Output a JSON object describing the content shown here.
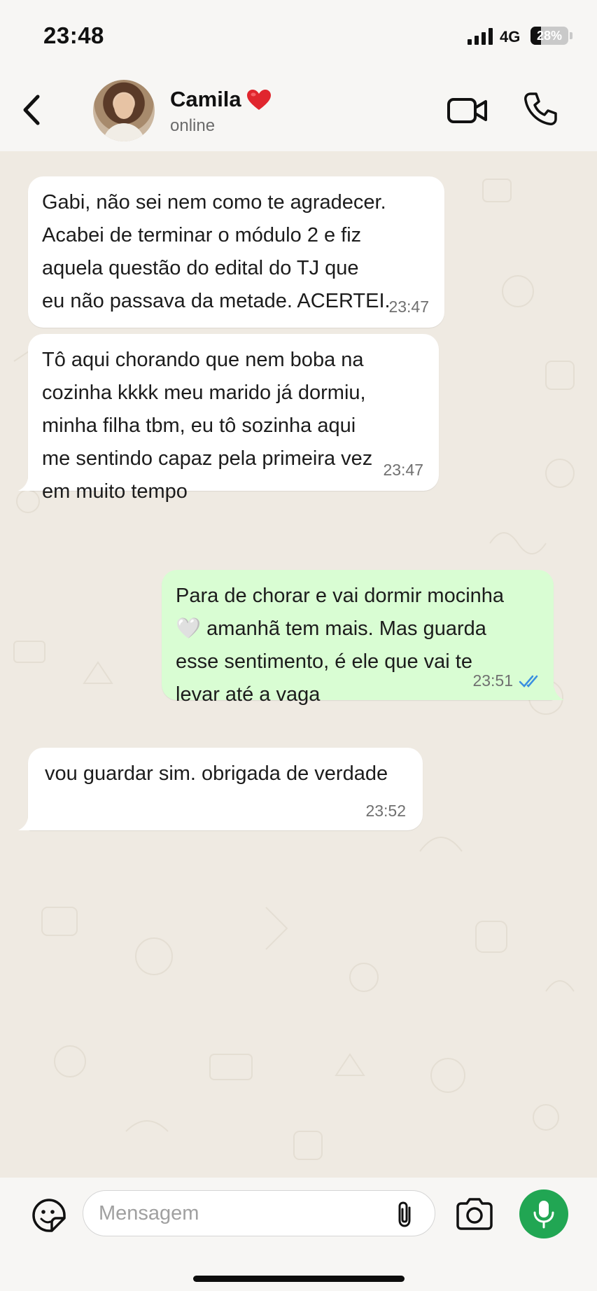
{
  "status_bar": {
    "time": "23:48",
    "network": "4G",
    "battery_text": "28%",
    "battery_level": 0.28
  },
  "header": {
    "contact_name": "Camila",
    "contact_status": "online",
    "heart_icon": "red-heart-icon",
    "icons": [
      "back-arrow-icon",
      "video-camera-icon",
      "phone-icon"
    ]
  },
  "messages": [
    {
      "direction": "incoming",
      "text": "Gabi, não sei nem como te agradecer.\nAcabei de terminar o módulo 2 e fiz\naquela questão do edital do TJ que\neu não passava da metade. ACERTEI.",
      "time": "23:47"
    },
    {
      "direction": "incoming",
      "text": "Tô aqui chorando que nem boba na\ncozinha kkkk meu marido já dormiu,\nminha filha tbm, eu tô sozinha aqui\nme sentindo capaz pela primeira vez\nem muito tempo",
      "time": "23:47"
    },
    {
      "direction": "outgoing",
      "text": "Para de chorar e vai dormir mocinha\n🤍 amanhã tem mais. Mas guarda\nesse sentimento, é ele que vai te\nlevar até a vaga",
      "time": "23:51",
      "status": "read"
    },
    {
      "direction": "incoming",
      "text": "vou guardar sim. obrigada de verdade",
      "time": "23:52"
    }
  ],
  "input_bar": {
    "placeholder": "Mensagem",
    "icons": [
      "sticker-icon",
      "paperclip-icon",
      "camera-icon",
      "microphone-icon"
    ]
  },
  "colors": {
    "incoming_bubble": "#ffffff",
    "outgoing_bubble": "#d9fdd3",
    "chat_background": "#efeae2",
    "mic_button": "#21a653",
    "read_receipt": "#3a8fe0"
  }
}
